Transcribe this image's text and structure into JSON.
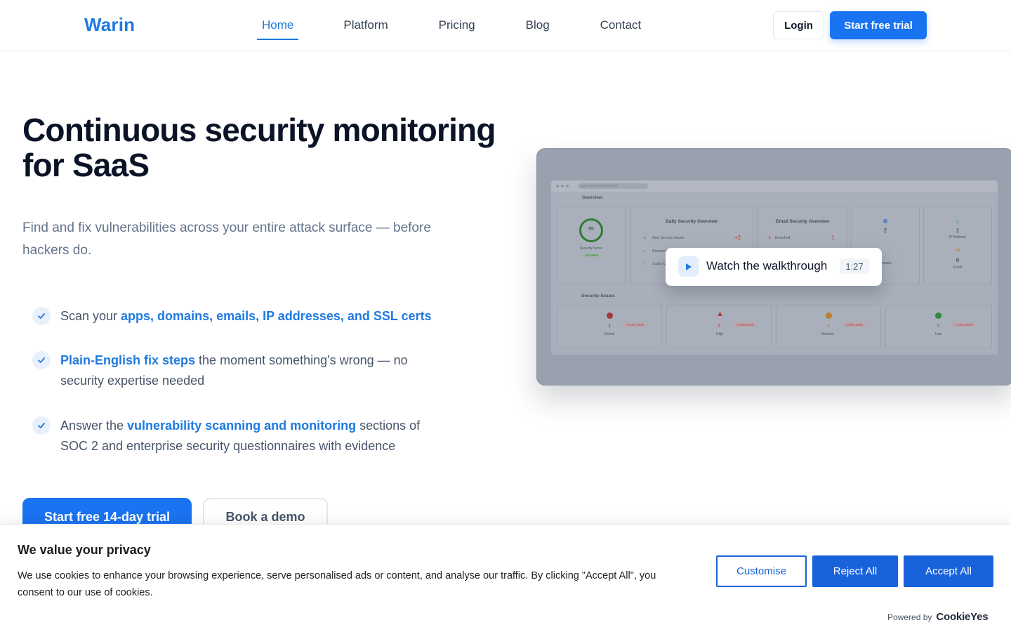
{
  "brand": {
    "name": "Warin",
    "color": "#1f7ae0"
  },
  "nav": {
    "items": [
      {
        "label": "Home",
        "active": true
      },
      {
        "label": "Platform",
        "active": false
      },
      {
        "label": "Pricing",
        "active": false
      },
      {
        "label": "Blog",
        "active": false
      },
      {
        "label": "Contact",
        "active": false
      }
    ],
    "login_label": "Login",
    "trial_label": "Start free trial"
  },
  "hero": {
    "title": "Continuous security monitoring for SaaS",
    "subtitle": "Find and fix vulnerabilities across your entire attack surface — before hackers do.",
    "features": [
      {
        "pre": "Scan your ",
        "highlight": "apps, domains, emails, IP addresses, and SSL certs",
        "post": ""
      },
      {
        "pre": "",
        "highlight": "Plain-English fix steps",
        "post": " the moment something's wrong — no security expertise needed"
      },
      {
        "pre": "Answer the ",
        "highlight": "vulnerability scanning and monitoring",
        "post": " sections of SOC 2 and enterprise security questionnaires with evidence"
      }
    ],
    "cta_primary": "Start free 14-day trial",
    "cta_secondary": "Book a demo"
  },
  "video": {
    "label": "Watch the walkthrough",
    "duration": "1:27",
    "dashboard": {
      "url": "app.warin.io/dashboard",
      "overview_label": "Overview",
      "score": "95",
      "score_label": "Security Score",
      "score_badge": "Excellent",
      "daily_title": "Daily Security Overview",
      "daily_rows": [
        {
          "label": "New Security Issues",
          "value": "+2"
        },
        {
          "label": "Resolved",
          "value": ""
        },
        {
          "label": "Scans C",
          "value": ""
        }
      ],
      "email_title": "Email Security Overview",
      "email_rows": [
        {
          "label": "Breached",
          "value": "1"
        }
      ],
      "domain": {
        "value": "2",
        "label": "Domain"
      },
      "ip": {
        "value": "1",
        "label": "IP Address"
      },
      "email": {
        "value": "6",
        "label": "Email"
      },
      "issues_label": "Security Issues",
      "severities": [
        {
          "name": "Critical",
          "value": "1",
          "delta": "+1 this week",
          "color": "#a33a3a"
        },
        {
          "name": "High",
          "value": "2",
          "delta": "+2 this week",
          "color": "#b33a3a"
        },
        {
          "name": "Medium",
          "value": "4",
          "delta": "+4 this week",
          "color": "#b98230"
        },
        {
          "name": "Low",
          "value": "3",
          "delta": "+2 this week",
          "color": "#2e8b3a"
        }
      ]
    }
  },
  "cookie": {
    "title": "We value your privacy",
    "text": "We use cookies to enhance your browsing experience, serve personalised ads or content, and analyse our traffic. By clicking \"Accept All\", you consent to our use of cookies.",
    "customise": "Customise",
    "reject": "Reject All",
    "accept": "Accept All",
    "powered_by": "Powered by",
    "provider": "CookieYes"
  }
}
